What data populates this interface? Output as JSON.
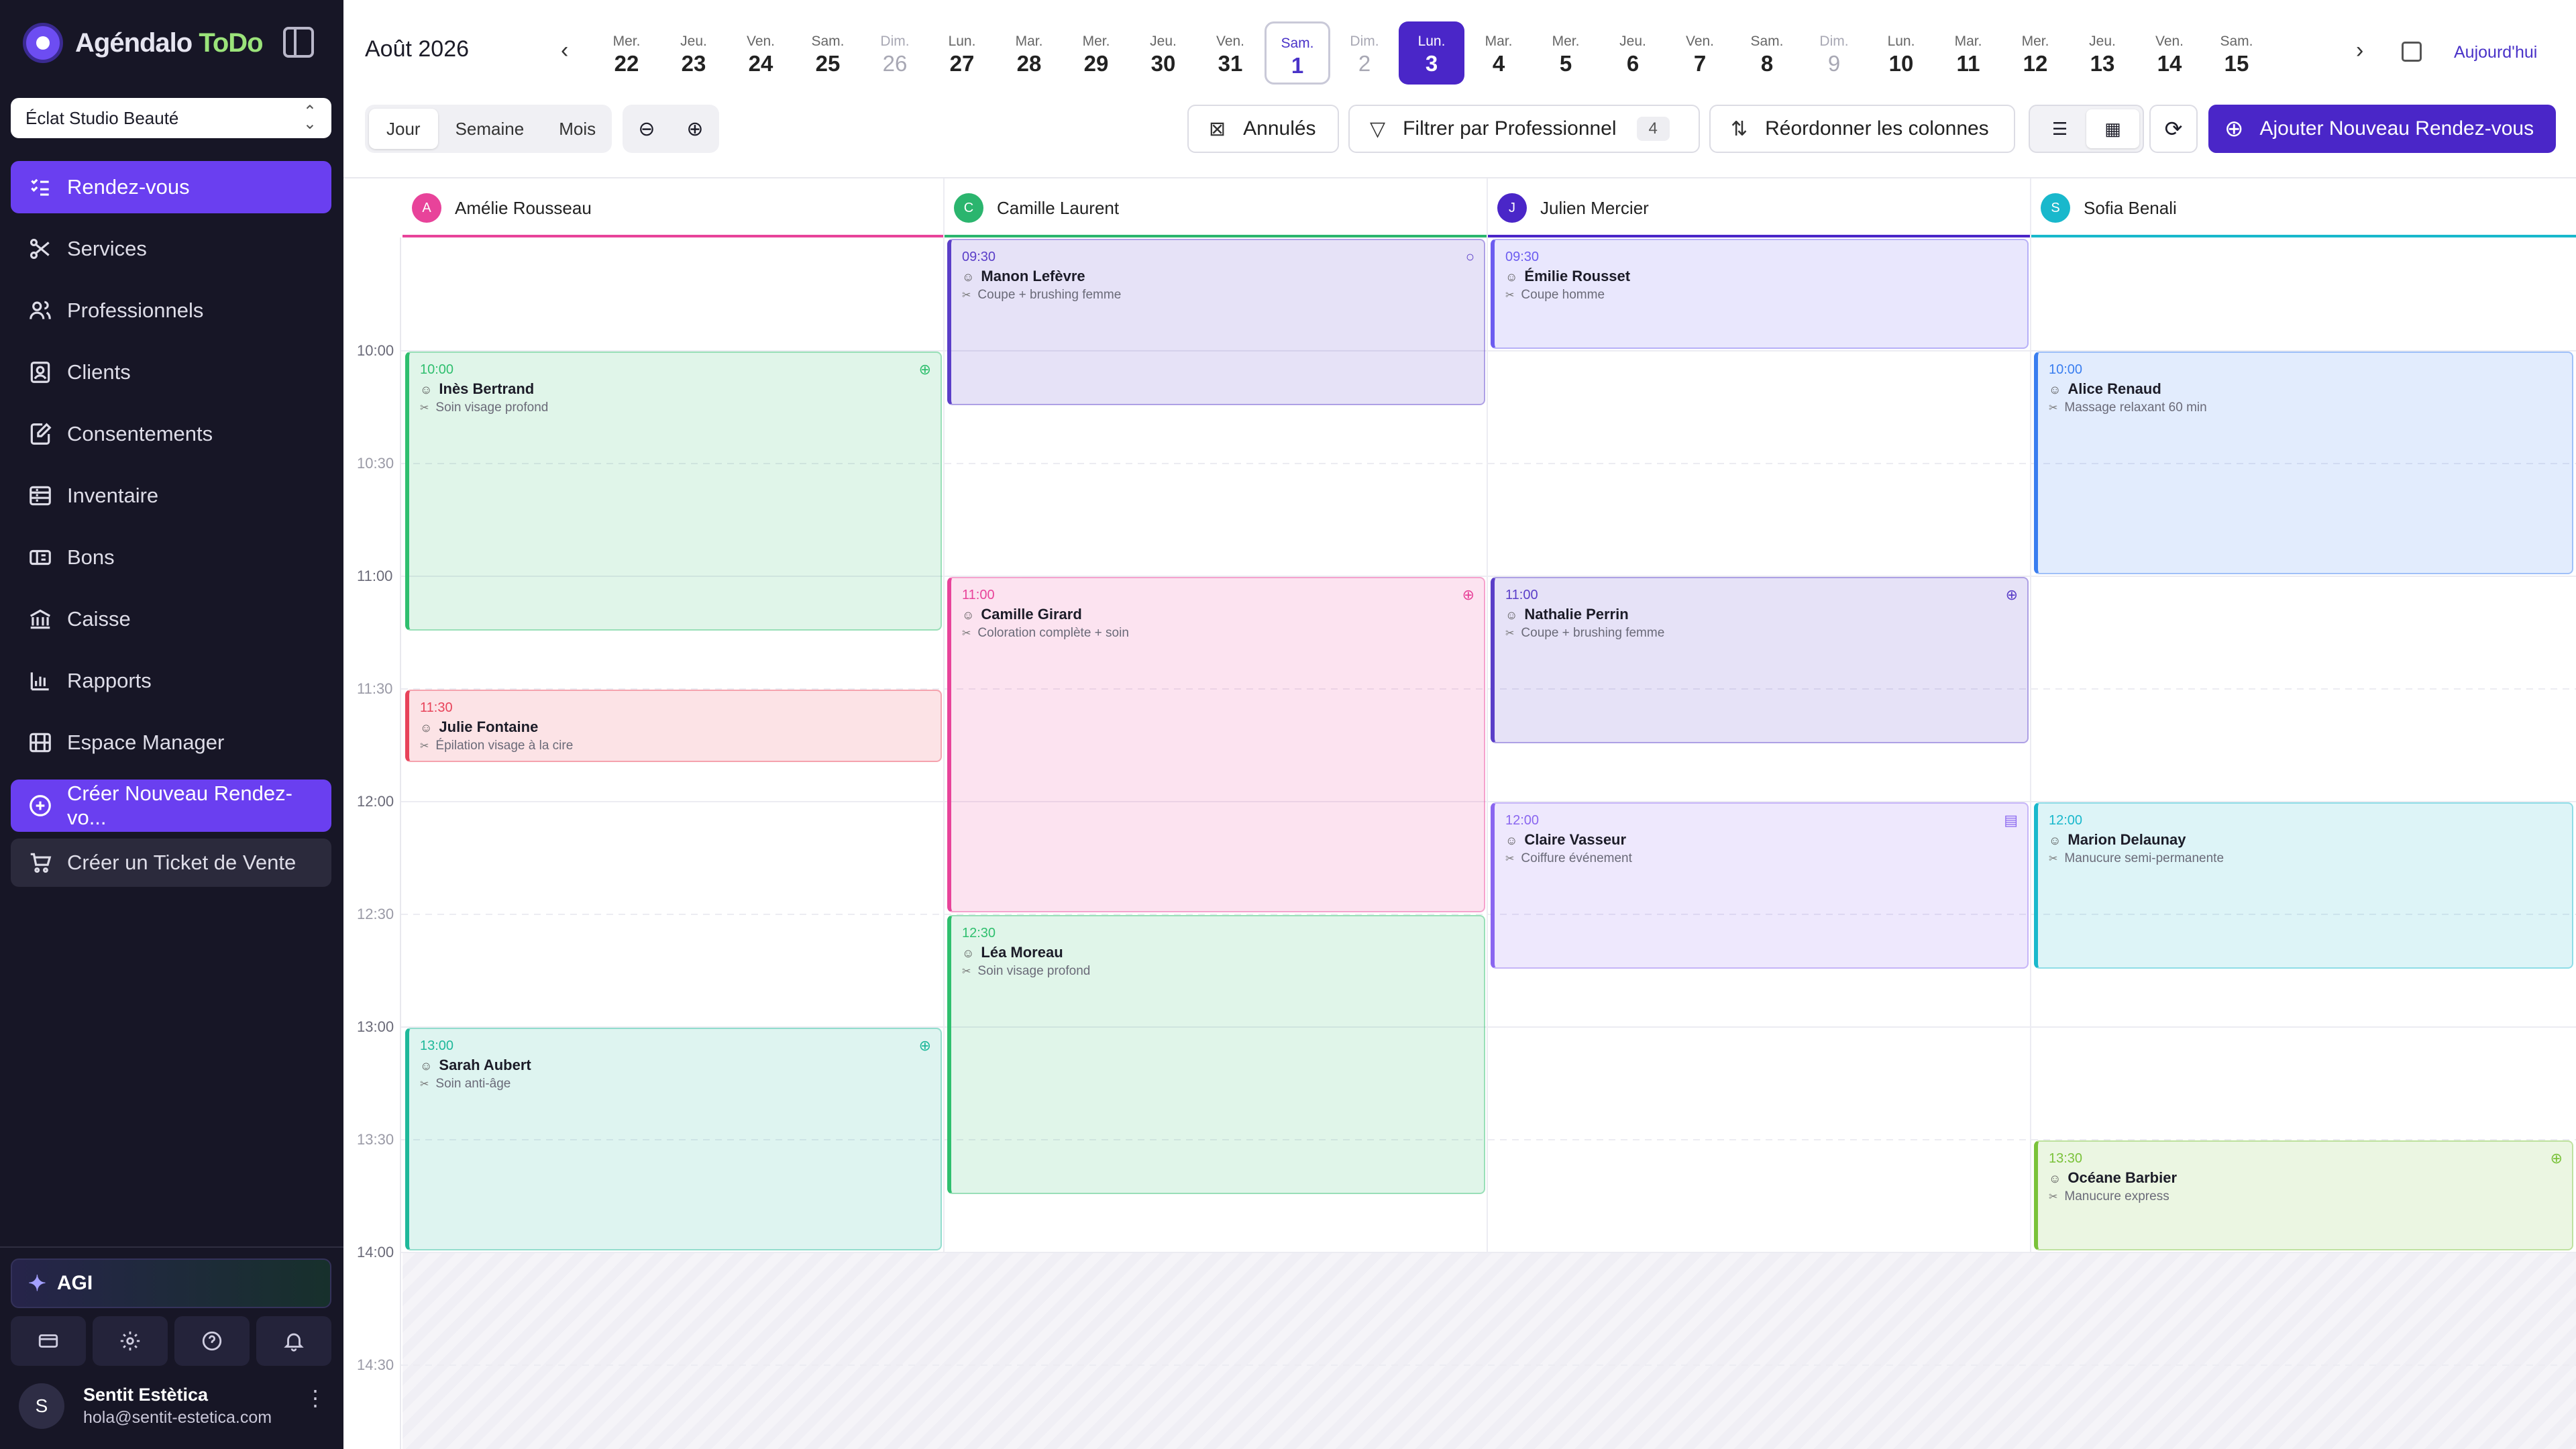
{
  "sidebar": {
    "logo_text": "Agéndalo",
    "logo_text2": "ToDo",
    "business": "Éclat Studio Beauté",
    "nav": [
      {
        "label": "Rendez-vous",
        "icon": "list-check-icon"
      },
      {
        "label": "Services",
        "icon": "scissors-icon"
      },
      {
        "label": "Professionnels",
        "icon": "users-icon"
      },
      {
        "label": "Clients",
        "icon": "contact-card-icon"
      },
      {
        "label": "Consentements",
        "icon": "edit-document-icon"
      },
      {
        "label": "Inventaire",
        "icon": "inventory-icon"
      },
      {
        "label": "Bons",
        "icon": "ticket-icon"
      },
      {
        "label": "Caisse",
        "icon": "bank-icon"
      },
      {
        "label": "Rapports",
        "icon": "bar-chart-icon"
      },
      {
        "label": "Espace Manager",
        "icon": "building-icon"
      }
    ],
    "create_appt": "Créer Nouveau Rendez-vo...",
    "create_ticket": "Créer un Ticket de Vente",
    "agi": "AGI",
    "user_initial": "S",
    "user_name": "Sentit Estètica",
    "user_email": "hola@sentit-estetica.com"
  },
  "header": {
    "month": "Août 2026",
    "today_label": "Aujourd'hui",
    "days": [
      {
        "dn": "Mer.",
        "dd": "22"
      },
      {
        "dn": "Jeu.",
        "dd": "23"
      },
      {
        "dn": "Ven.",
        "dd": "24"
      },
      {
        "dn": "Sam.",
        "dd": "25"
      },
      {
        "dn": "Dim.",
        "dd": "26"
      },
      {
        "dn": "Lun.",
        "dd": "27"
      },
      {
        "dn": "Mar.",
        "dd": "28"
      },
      {
        "dn": "Mer.",
        "dd": "29"
      },
      {
        "dn": "Jeu.",
        "dd": "30"
      },
      {
        "dn": "Ven.",
        "dd": "31"
      },
      {
        "dn": "Sam.",
        "dd": "1"
      },
      {
        "dn": "Dim.",
        "dd": "2"
      },
      {
        "dn": "Lun.",
        "dd": "3"
      },
      {
        "dn": "Mar.",
        "dd": "4"
      },
      {
        "dn": "Mer.",
        "dd": "5"
      },
      {
        "dn": "Jeu.",
        "dd": "6"
      },
      {
        "dn": "Ven.",
        "dd": "7"
      },
      {
        "dn": "Sam.",
        "dd": "8"
      },
      {
        "dn": "Dim.",
        "dd": "9"
      },
      {
        "dn": "Lun.",
        "dd": "10"
      },
      {
        "dn": "Mar.",
        "dd": "11"
      },
      {
        "dn": "Mer.",
        "dd": "12"
      },
      {
        "dn": "Jeu.",
        "dd": "13"
      },
      {
        "dn": "Ven.",
        "dd": "14"
      },
      {
        "dn": "Sam.",
        "dd": "15"
      }
    ],
    "today_index": 10,
    "selected_index": 12
  },
  "toolbar": {
    "views": [
      "Jour",
      "Semaine",
      "Mois"
    ],
    "cancelled": "Annulés",
    "filter": "Filtrer par Professionnel",
    "filter_count": "4",
    "reorder": "Réordonner les colonnes",
    "add": "Ajouter Nouveau Rendez-vous"
  },
  "columns": [
    {
      "name": "Amélie Rousseau",
      "initial": "A",
      "color": "#e8439a"
    },
    {
      "name": "Camille Laurent",
      "initial": "C",
      "color": "#2bb56e"
    },
    {
      "name": "Julien Mercier",
      "initial": "J",
      "color": "#4a26c8"
    },
    {
      "name": "Sofia Benali",
      "initial": "S",
      "color": "#19b8cc"
    }
  ],
  "times": [
    "10:00",
    "10:30",
    "11:00",
    "11:30",
    "12:00",
    "12:30",
    "13:00",
    "13:30",
    "14:00",
    "14:30"
  ],
  "events": [
    {
      "col": 0,
      "start": "10:00",
      "end": "11:15",
      "time": "10:00",
      "client": "Inès Bertrand",
      "service": "Soin visage profond",
      "color": "#2fbf6e",
      "icon": "globe-icon"
    },
    {
      "col": 0,
      "start": "11:30",
      "end": "11:50",
      "time": "11:30",
      "client": "Julie Fontaine",
      "service": "Épilation visage à la cire",
      "color": "#e8435a",
      "icon": ""
    },
    {
      "col": 0,
      "start": "13:00",
      "end": "14:00",
      "time": "13:00",
      "client": "Sarah Aubert",
      "service": "Soin anti-âge",
      "color": "#1fb89a",
      "icon": "globe-icon"
    },
    {
      "col": 1,
      "start": "09:30",
      "end": "10:15",
      "time": "09:30",
      "client": "Manon Lefèvre",
      "service": "Coupe + brushing femme",
      "color": "#5a3ec8",
      "icon": "comment-icon"
    },
    {
      "col": 1,
      "start": "11:00",
      "end": "12:30",
      "time": "11:00",
      "client": "Camille Girard",
      "service": "Coloration complète + soin",
      "color": "#e8439a",
      "icon": "globe-icon"
    },
    {
      "col": 1,
      "start": "12:30",
      "end": "13:45",
      "time": "12:30",
      "client": "Léa Moreau",
      "service": "Soin visage profond",
      "color": "#2fbf6e",
      "icon": ""
    },
    {
      "col": 2,
      "start": "09:30",
      "end": "10:00",
      "time": "09:30",
      "client": "Émilie Rousset",
      "service": "Coupe homme",
      "color": "#6c5cf0",
      "icon": ""
    },
    {
      "col": 2,
      "start": "11:00",
      "end": "11:45",
      "time": "11:00",
      "client": "Nathalie Perrin",
      "service": "Coupe + brushing femme",
      "color": "#5a3ec8",
      "icon": "globe-icon"
    },
    {
      "col": 2,
      "start": "12:00",
      "end": "12:45",
      "time": "12:00",
      "client": "Claire Vasseur",
      "service": "Coiffure événement",
      "color": "#8a66f0",
      "icon": "ticket-icon"
    },
    {
      "col": 3,
      "start": "10:00",
      "end": "11:00",
      "time": "10:00",
      "client": "Alice Renaud",
      "service": "Massage relaxant 60 min",
      "color": "#3a7ef0",
      "icon": ""
    },
    {
      "col": 3,
      "start": "12:00",
      "end": "12:45",
      "time": "12:00",
      "client": "Marion Delaunay",
      "service": "Manucure semi-permanente",
      "color": "#19b8cc",
      "icon": ""
    },
    {
      "col": 3,
      "start": "13:30",
      "end": "14:00",
      "time": "13:30",
      "client": "Océane Barbier",
      "service": "Manucure express",
      "color": "#7ac23a",
      "icon": "globe-icon"
    }
  ]
}
